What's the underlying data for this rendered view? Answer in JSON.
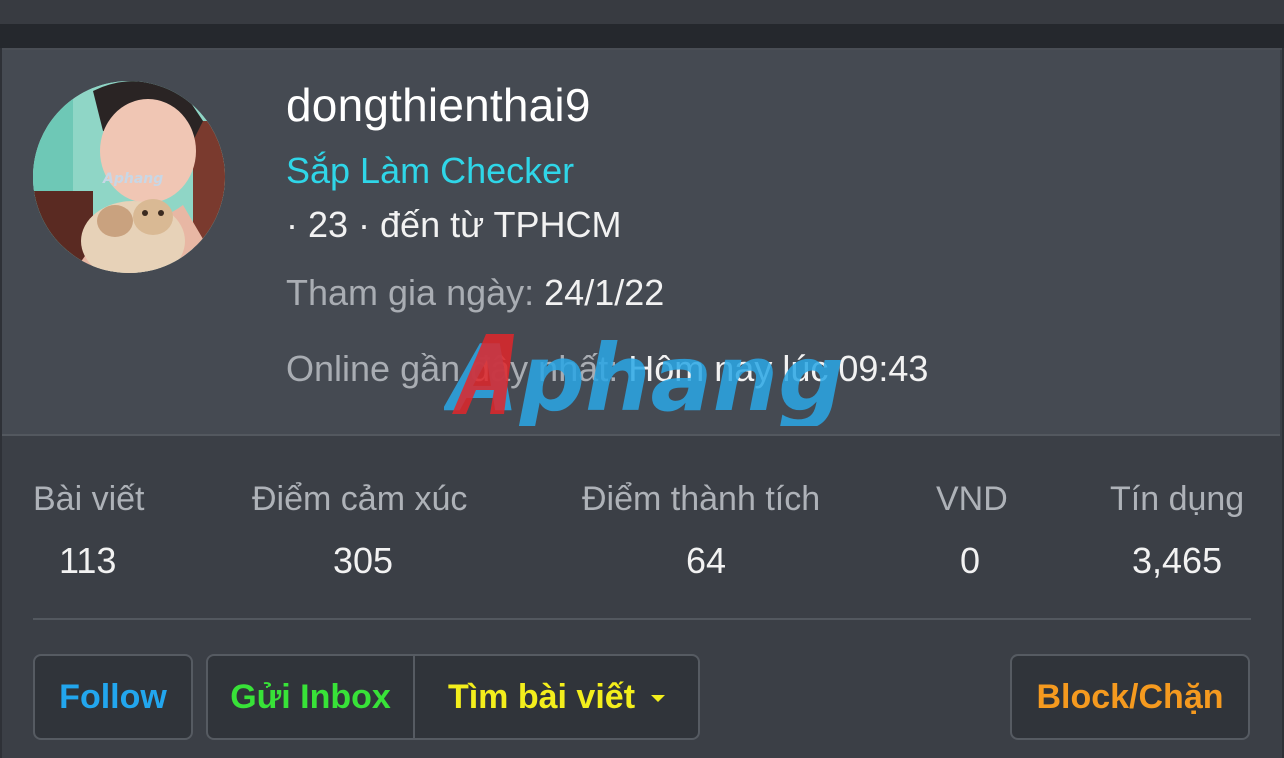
{
  "profile": {
    "username": "dongthienthai9",
    "title": "Sắp Làm Checker",
    "meta": "· 23 · đến từ TPHCM",
    "joined_label": "Tham gia ngày:",
    "joined_value": "24/1/22",
    "lastseen_label": "Online gần đây nhất:",
    "lastseen_value": "Hôm nay lúc 09:43",
    "avatar_watermark": "Aphang"
  },
  "watermark": {
    "text": "Aphang",
    "colors": [
      "#e0262a",
      "#2aa7e6"
    ]
  },
  "stats": [
    {
      "label": "Bài viết",
      "value": "113"
    },
    {
      "label": "Điểm cảm xúc",
      "value": "305"
    },
    {
      "label": "Điểm thành tích",
      "value": "64"
    },
    {
      "label": "VND",
      "value": "0"
    },
    {
      "label": "Tín dụng",
      "value": "3,465"
    }
  ],
  "actions": {
    "follow": "Follow",
    "inbox": "Gửi Inbox",
    "find_posts": "Tìm bài viết",
    "block": "Block/Chặn",
    "dropdown_icon": "caret-down-icon"
  },
  "colors": {
    "title": "#2fd6e8",
    "follow": "#22a6ee",
    "inbox": "#38e238",
    "find_posts": "#f3ee1c",
    "block": "#f59a1f"
  }
}
